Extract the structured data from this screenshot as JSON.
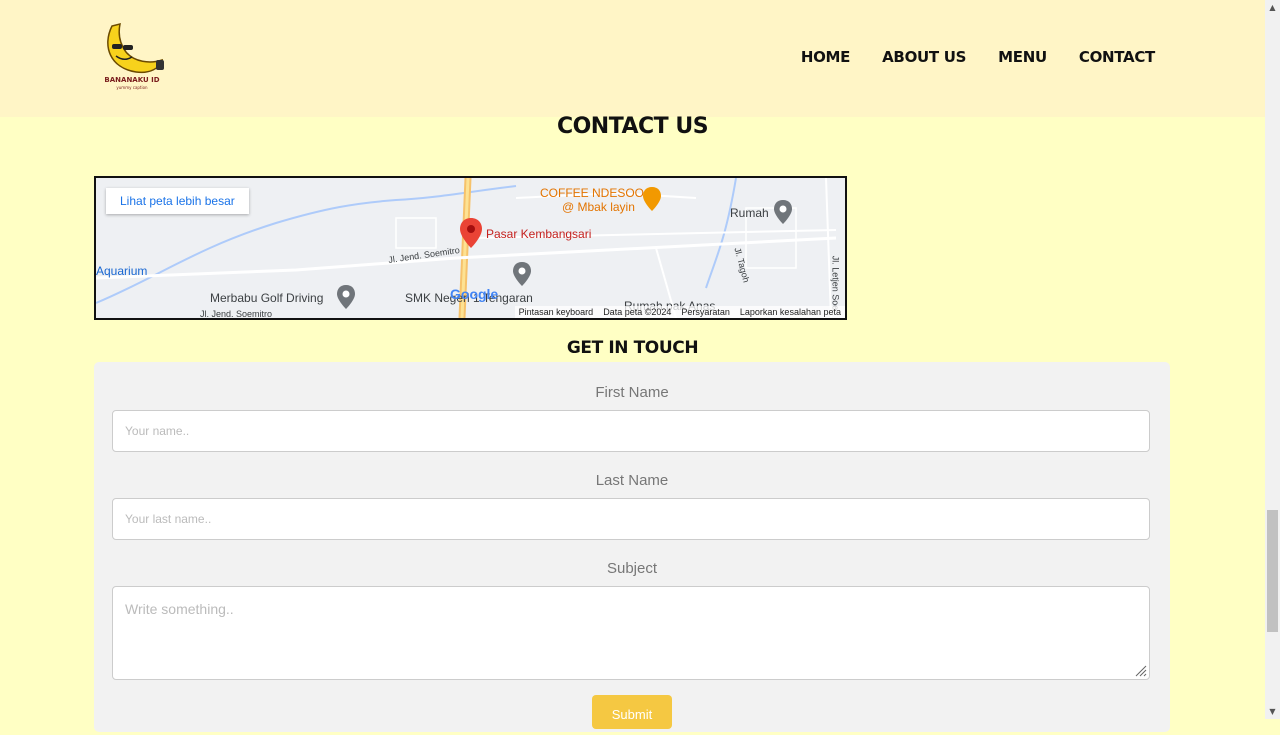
{
  "header": {
    "logo_text": "BANANAKU ID",
    "logo_tagline": "yummy caption",
    "nav": [
      "HOME",
      "ABOUT US",
      "MENU",
      "CONTACT"
    ]
  },
  "page_title": "CONTACT US",
  "map": {
    "larger_map_button": "Lihat peta lebih besar",
    "places": {
      "pasar": "Pasar Kembangsari",
      "coffee_line1": "COFFEE NDESOO",
      "coffee_line2": "@ Mbak layin",
      "rumah": "Rumah",
      "aquarium": "Aquarium",
      "merbabu": "Merbabu Golf Driving",
      "smk": "SMK Negeri 1 Tengaran",
      "rumah_pak": "Rumah pak Anas",
      "jl_soemitro": "Jl. Jend. Soemitro",
      "jl_soemitro2": "Jl. Jend. Soemitro",
      "jl_tagoh": "Jl. Tagoh",
      "jl_letjen": "Jl. Letjen Soe"
    },
    "google": "Google",
    "footer": [
      "Pintasan keyboard",
      "Data peta ©2024",
      "Persyaratan",
      "Laporkan kesalahan peta"
    ]
  },
  "form": {
    "title": "GET IN TOUCH",
    "first_name_label": "First Name",
    "first_name_placeholder": "Your name..",
    "last_name_label": "Last Name",
    "last_name_placeholder": "Your last name..",
    "subject_label": "Subject",
    "subject_placeholder": "Write something..",
    "submit_label": "Submit"
  },
  "colors": {
    "page_bg": "#ffffc4",
    "header_bg": "#fff5c6",
    "form_bg": "#f2f2f2",
    "submit_bg": "#f5c842",
    "map_pin": "#ea4335"
  }
}
